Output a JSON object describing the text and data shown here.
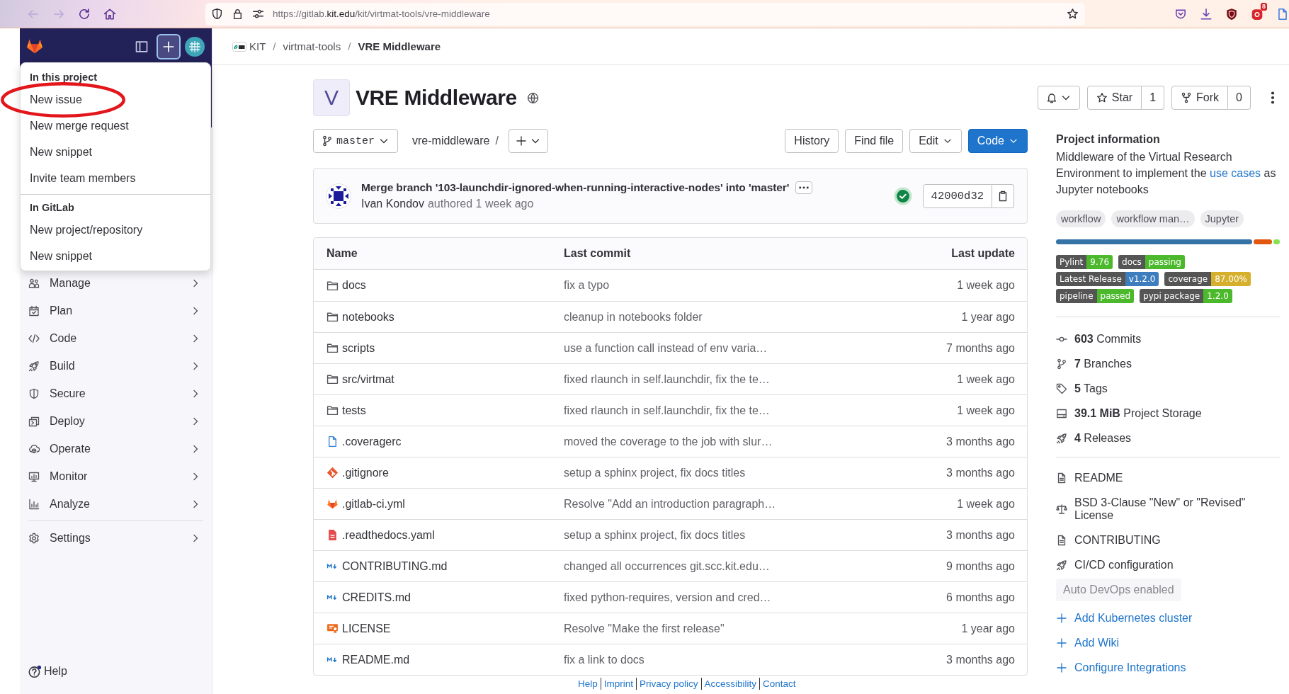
{
  "browser": {
    "back": {
      "disabled": true
    },
    "forward": {
      "disabled": true
    },
    "url": {
      "prefix": "https://gitlab.",
      "domain": "kit.edu",
      "path": "/kit/virtmat-tools/vre-middleware"
    },
    "extension_badge": "8"
  },
  "sidebar": {
    "new_button": {
      "expanded": true
    },
    "new_menu": {
      "sections": [
        {
          "title": "In this project",
          "items": [
            {
              "label": "New issue",
              "highlighted": true
            },
            {
              "label": "New merge request",
              "highlighted": false
            },
            {
              "label": "New snippet",
              "highlighted": false
            },
            {
              "label": "Invite team members",
              "highlighted": false
            }
          ]
        },
        {
          "title": "In GitLab",
          "items": [
            {
              "label": "New project/repository",
              "highlighted": false
            },
            {
              "label": "New snippet",
              "highlighted": false
            }
          ]
        }
      ]
    },
    "nav_groups": [
      {
        "items": [
          {
            "label": "Manage"
          },
          {
            "label": "Plan"
          },
          {
            "label": "Code"
          },
          {
            "label": "Build"
          },
          {
            "label": "Secure"
          },
          {
            "label": "Deploy"
          },
          {
            "label": "Operate"
          },
          {
            "label": "Monitor"
          },
          {
            "label": "Analyze"
          }
        ]
      },
      {
        "items": [
          {
            "label": "Settings"
          }
        ]
      }
    ],
    "help": "Help"
  },
  "breadcrumb": [
    {
      "label": "KIT",
      "current": false
    },
    {
      "separator": "/",
      "label": "virtmat-tools",
      "current": false
    },
    {
      "separator": "/",
      "label": "VRE Middleware",
      "current": true
    }
  ],
  "project": {
    "avatar_letter": "V",
    "title": "VRE Middleware",
    "star": {
      "label": "Star",
      "count": "1"
    },
    "fork": {
      "label": "Fork",
      "count": "0"
    }
  },
  "repo_toolbar": {
    "branch": "master",
    "path": "vre-middleware",
    "path_separator": "/",
    "actions": [
      {
        "label": "History",
        "kind": "default",
        "dropdown": false
      },
      {
        "label": "Find file",
        "kind": "default",
        "dropdown": false
      },
      {
        "label": "Edit",
        "kind": "default",
        "dropdown": true
      },
      {
        "label": "Code",
        "kind": "primary",
        "dropdown": true
      }
    ]
  },
  "last_commit": {
    "title": "Merge branch '103-launchdir-ignored-when-running-interactive-nodes' into 'master'",
    "author": "Ivan Kondov",
    "time": "authored 1 week ago",
    "pipeline": {
      "passed": true
    },
    "sha": "42000d32"
  },
  "files": {
    "columns": [
      "Name",
      "Last commit",
      "Last update"
    ],
    "rows": [
      {
        "kind": "folder",
        "name": "docs",
        "commit": "fix a typo",
        "updated": "1 week ago"
      },
      {
        "kind": "folder",
        "name": "notebooks",
        "commit": "cleanup in notebooks folder",
        "updated": "1 year ago"
      },
      {
        "kind": "folder",
        "name": "scripts",
        "commit": "use a function call instead of env varia…",
        "updated": "7 months ago"
      },
      {
        "kind": "folder",
        "name": "src/virtmat",
        "commit": "fixed rlaunch in self.launchdir, fix the te…",
        "updated": "1 week ago"
      },
      {
        "kind": "folder",
        "name": "tests",
        "commit": "fixed rlaunch in self.launchdir, fix the te…",
        "updated": "1 week ago"
      },
      {
        "kind": "file",
        "name": ".coveragerc",
        "commit": "moved the coverage to the job with slur…",
        "updated": "3 months ago"
      },
      {
        "kind": "git",
        "name": ".gitignore",
        "commit": "setup a sphinx project, fix docs titles",
        "updated": "3 months ago"
      },
      {
        "kind": "gitlab-ci",
        "name": ".gitlab-ci.yml",
        "commit": "Resolve \"Add an introduction paragraph…",
        "updated": "1 week ago"
      },
      {
        "kind": "readthedocs",
        "name": ".readthedocs.yaml",
        "commit": "setup a sphinx project, fix docs titles",
        "updated": "3 months ago"
      },
      {
        "kind": "markdown",
        "name": "CONTRIBUTING.md",
        "commit": "changed all occurrences git.scc.kit.edu…",
        "updated": "9 months ago"
      },
      {
        "kind": "markdown",
        "name": "CREDITS.md",
        "commit": "fixed python-requires, version and cred…",
        "updated": "6 months ago"
      },
      {
        "kind": "license",
        "name": "LICENSE",
        "commit": "Resolve \"Make the first release\"",
        "updated": "1 year ago"
      },
      {
        "kind": "markdown",
        "name": "README.md",
        "commit": "fix a link to docs",
        "updated": "3 months ago"
      }
    ]
  },
  "project_info": {
    "title": "Project information",
    "description": {
      "before": "Middleware of the Virtual Research Environment to implement the ",
      "link": "use cases",
      "after": " as Jupyter notebooks"
    },
    "topics": [
      "workflow",
      "workflow man…",
      "Jupyter"
    ],
    "badges": [
      {
        "label": "Pylint",
        "value": "9.76",
        "color": "#4cb92c"
      },
      {
        "label": "docs",
        "value": "passing",
        "color": "#4cb92c"
      },
      {
        "label": "Latest Release",
        "value": "v1.2.0",
        "color": "#3d7dbd"
      },
      {
        "label": "coverage",
        "value": "87.00%",
        "color": "#d6af2c"
      },
      {
        "label": "pipeline",
        "value": "passed",
        "color": "#4cb92c"
      },
      {
        "label": "pypi package",
        "value": "1.2.0",
        "color": "#4cb92c"
      }
    ],
    "stats": [
      "**603** Commits",
      "**7** Branches",
      "**5** Tags",
      "**39.1 MiB** Project Storage",
      "**4** Releases"
    ],
    "links": [
      "README",
      "BSD 3-Clause \"New\" or \"Revised\" License",
      "CONTRIBUTING",
      "CI/CD configuration"
    ],
    "auto_devops": "Auto DevOps enabled",
    "add_links": [
      "Add Kubernetes cluster",
      "Add Wiki",
      "Configure Integrations"
    ]
  },
  "footer": {
    "links": [
      "Help",
      "Imprint",
      "Privacy policy",
      "Accessibility",
      "Contact"
    ]
  }
}
